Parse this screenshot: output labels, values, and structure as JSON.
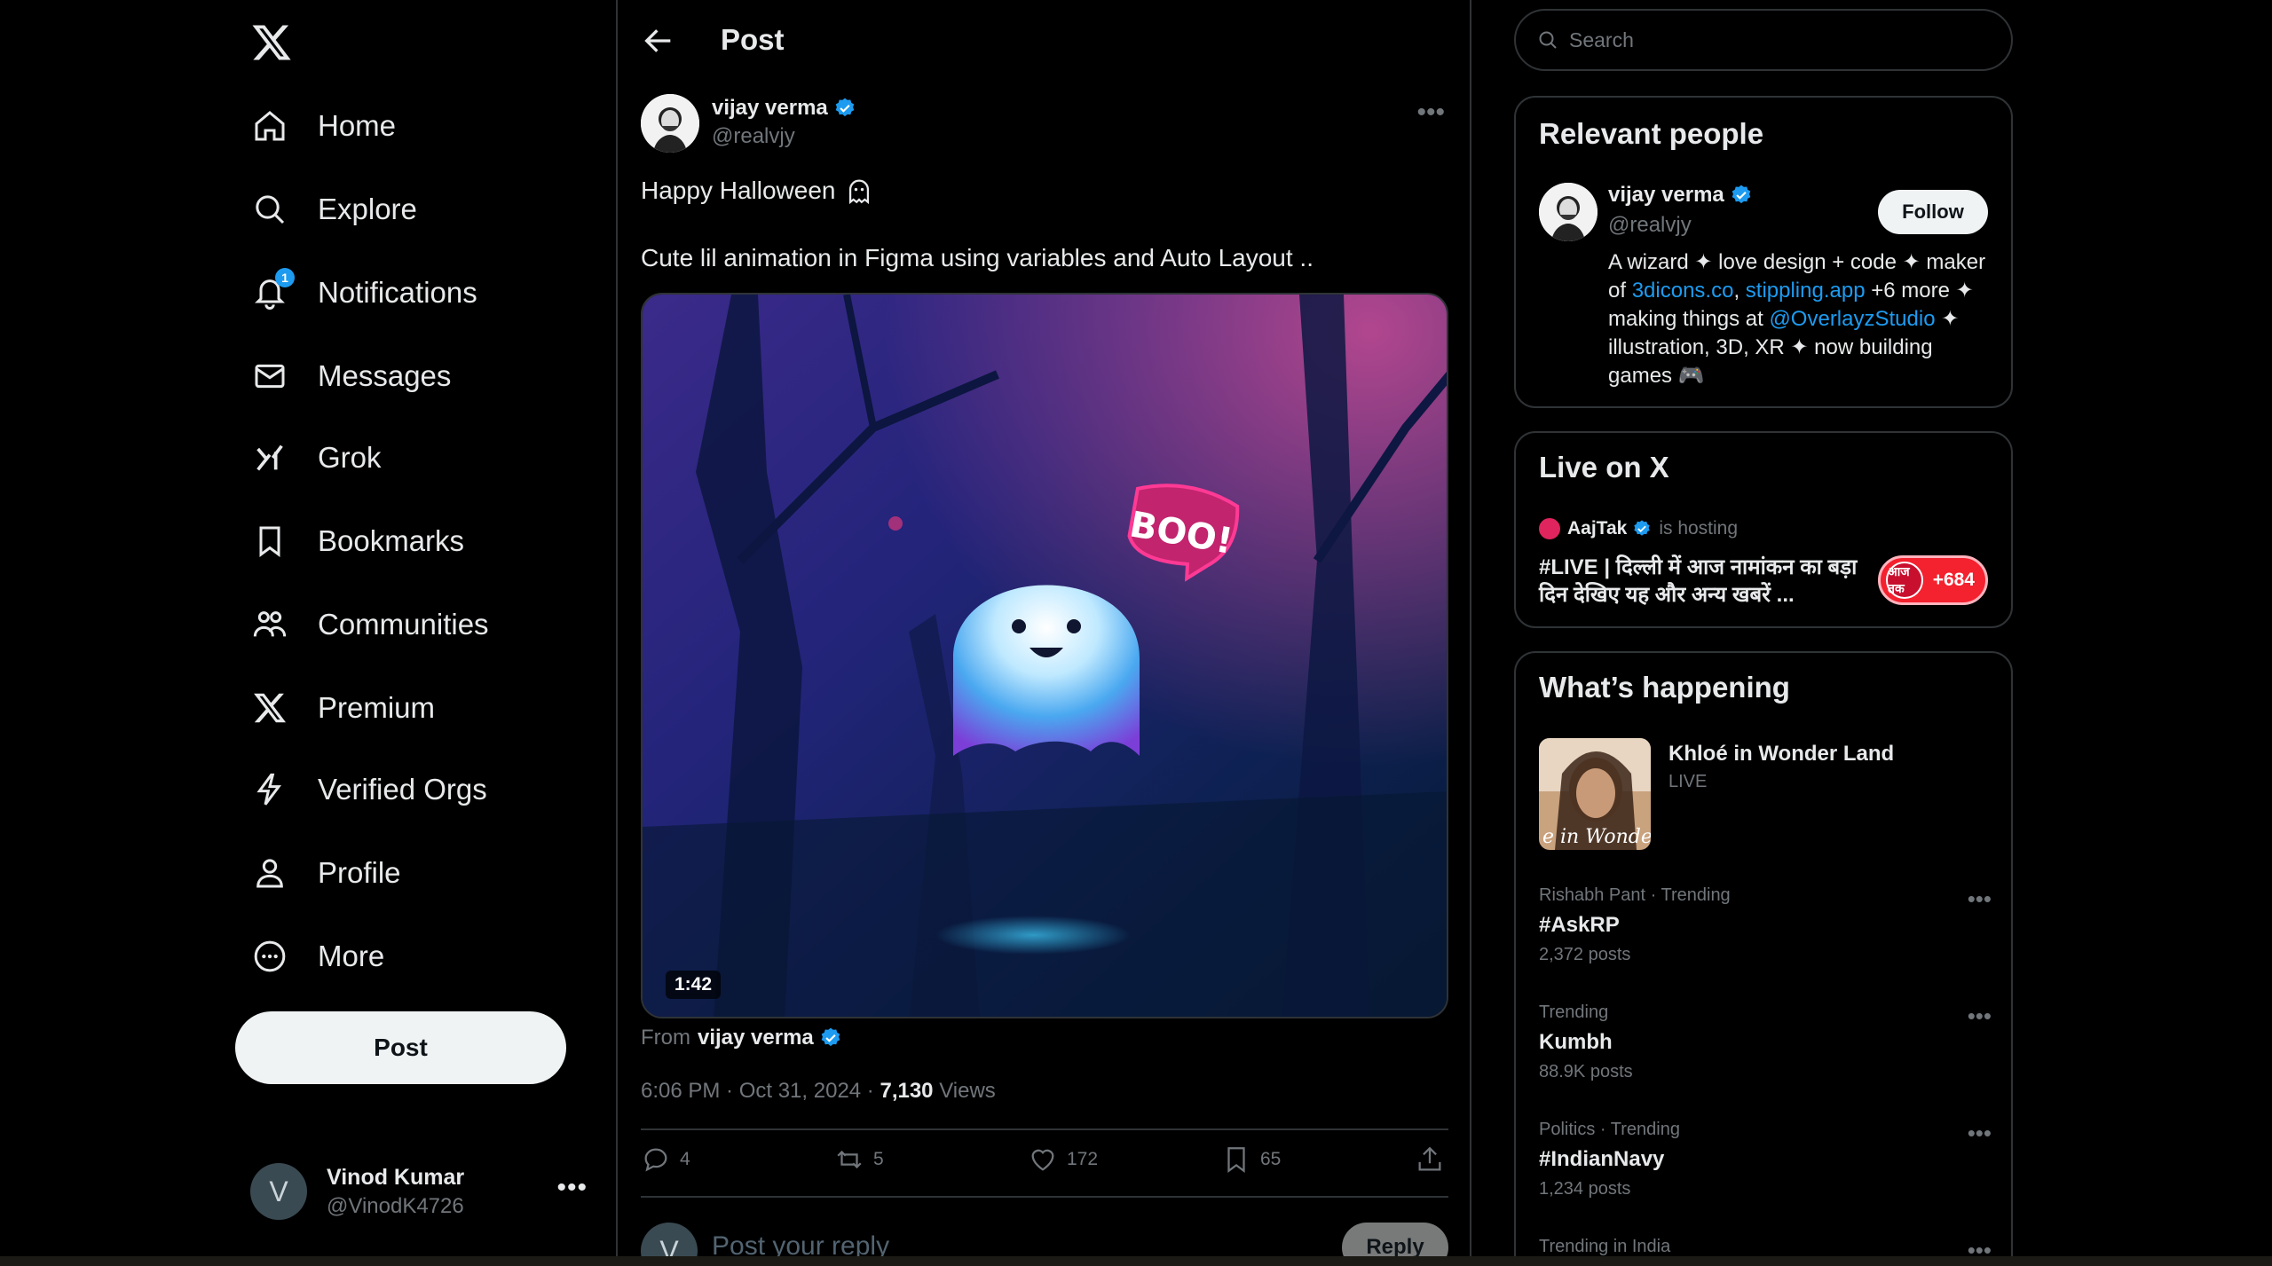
{
  "nav": {
    "items": [
      {
        "label": "Home",
        "icon": "home-icon"
      },
      {
        "label": "Explore",
        "icon": "search-icon"
      },
      {
        "label": "Notifications",
        "icon": "bell-icon",
        "badge": "1"
      },
      {
        "label": "Messages",
        "icon": "envelope-icon"
      },
      {
        "label": "Grok",
        "icon": "grok-icon"
      },
      {
        "label": "Bookmarks",
        "icon": "bookmark-icon"
      },
      {
        "label": "Communities",
        "icon": "communities-icon"
      },
      {
        "label": "Premium",
        "icon": "x-logo-icon"
      },
      {
        "label": "Verified Orgs",
        "icon": "lightning-icon"
      },
      {
        "label": "Profile",
        "icon": "person-icon"
      },
      {
        "label": "More",
        "icon": "more-circle-icon"
      }
    ],
    "post_button": "Post",
    "account": {
      "avatar_letter": "V",
      "name": "Vinod Kumar",
      "handle": "@VinodK4726",
      "menu": "•••"
    }
  },
  "header": {
    "title": "Post"
  },
  "post": {
    "author_name": "vijay verma",
    "author_handle": "@realvjy",
    "menu": "•••",
    "line1": "Happy Halloween",
    "line2": "Cute lil animation in Figma using variables and Auto Layout ..",
    "media": {
      "duration": "1:42",
      "sticker_text": "BOO!"
    },
    "from_label": "From",
    "from_name": "vijay verma",
    "timestamp": "6:06 PM · Oct 31, 2024 · ",
    "views_count": "7,130",
    "views_label": " Views",
    "actions": {
      "replies": "4",
      "reposts": "5",
      "likes": "172",
      "bookmarks": "65"
    },
    "reply": {
      "avatar_letter": "V",
      "placeholder": "Post your reply",
      "button": "Reply"
    }
  },
  "sidebar": {
    "search_placeholder": "Search",
    "relevant": {
      "title": "Relevant people",
      "name": "vijay verma",
      "handle": "@realvjy",
      "follow": "Follow",
      "bio_1": "A wizard ✦ love design + code ✦ maker of ",
      "bio_link1": "3dicons.co",
      "bio_2": ", ",
      "bio_link2": "stippling.app",
      "bio_3": " +6 more ✦ making things at ",
      "bio_link3": "@OverlayzStudio",
      "bio_4": " ✦ illustration, 3D, XR ✦ now building games 🎮"
    },
    "live": {
      "title": "Live on X",
      "host_name": "AajTak",
      "host_suffix": "is hosting",
      "stream_title": "#LIVE | दिल्ली में आज नामांकन का बड़ा दिन  देखिए यह और अन्य खबरें ...",
      "listeners": "+684",
      "avatar_text": "आज तक"
    },
    "happening": {
      "title": "What’s happening",
      "live_event": {
        "title": "Khloé in Wonder Land",
        "subtitle": "LIVE",
        "thumb_text": "e in Wonder L"
      },
      "trends": [
        {
          "context": "Rishabh Pant · Trending",
          "topic": "#AskRP",
          "posts": "2,372 posts"
        },
        {
          "context": "Trending",
          "topic": "Kumbh",
          "posts": "88.9K posts"
        },
        {
          "context": "Politics · Trending",
          "topic": "#IndianNavy",
          "posts": "1,234 posts"
        },
        {
          "context": "Trending in India",
          "topic": "",
          "posts": ""
        }
      ]
    }
  },
  "colors": {
    "accent": "#1d9bf0",
    "background": "#000000",
    "border": "#2f3336",
    "muted": "#71767b"
  }
}
